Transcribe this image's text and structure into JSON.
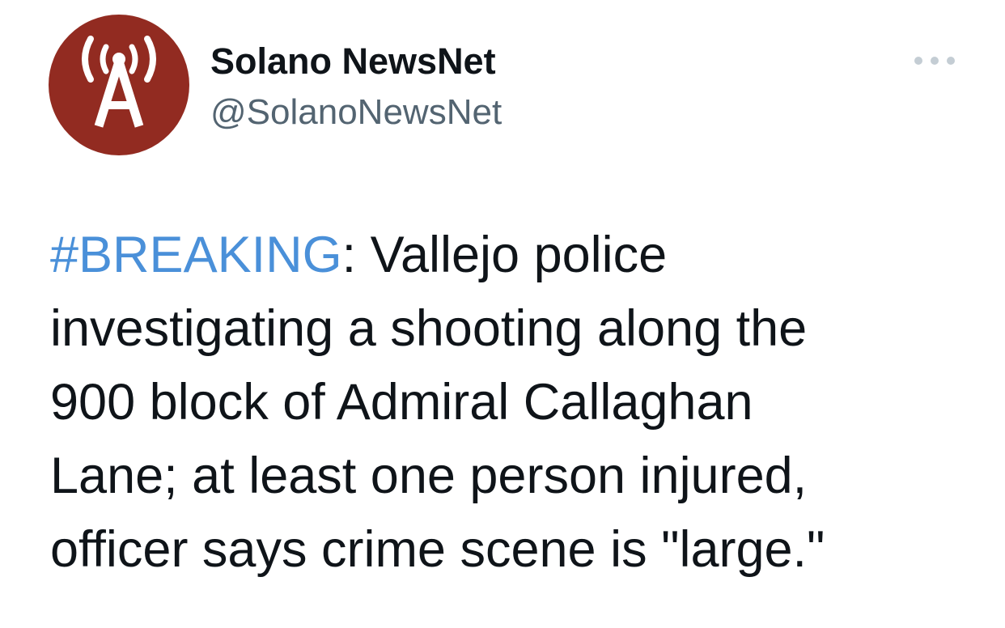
{
  "tweet": {
    "author": {
      "display_name": "Solano NewsNet",
      "handle": "@SolanoNewsNet",
      "avatar": {
        "icon": "broadcast-antenna-icon",
        "background_color": "#922b21",
        "glyph_color": "#ffffff"
      }
    },
    "more_menu": {
      "icon": "more-options-icon"
    },
    "text": {
      "hashtag": "#BREAKING",
      "hashtag_color": "#4a90d9",
      "after_hashtag": ": Vallejo police",
      "line_2": "investigating a shooting along the",
      "line_3": "900 block of Admiral Callaghan",
      "line_4": "Lane; at least one person injured,",
      "line_5": "officer says crime scene is \"large.\""
    }
  }
}
